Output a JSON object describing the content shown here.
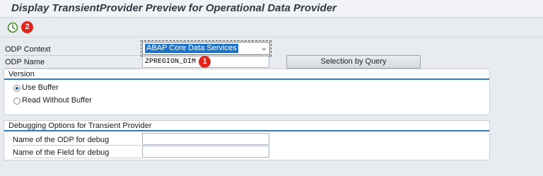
{
  "window": {
    "title": "Display TransientProvider Preview for Operational Data Provider"
  },
  "toolbar": {
    "execute_icon": "execute-clock-icon",
    "badge_2": "2"
  },
  "form": {
    "odp_context_label": "ODP Context",
    "odp_context_value": "ABAP Core Data Services",
    "odp_name_label": "ODP Name",
    "odp_name_value": "ZPREGION_DIM",
    "badge_1": "1",
    "selection_button": "Selection by Query"
  },
  "version": {
    "title": "Version",
    "use_buffer": "Use Buffer",
    "read_without_buffer": "Read Without Buffer",
    "selected": "use_buffer"
  },
  "debug": {
    "title": "Debugging Options for Transient Provider",
    "odp_label": "Name of the ODP for debug",
    "odp_value": "",
    "field_label": "Name of the Field for debug",
    "field_value": ""
  },
  "colors": {
    "accent_blue": "#2e7bc4",
    "badge_red": "#e2231a",
    "selection_blue": "#1e73c8"
  }
}
